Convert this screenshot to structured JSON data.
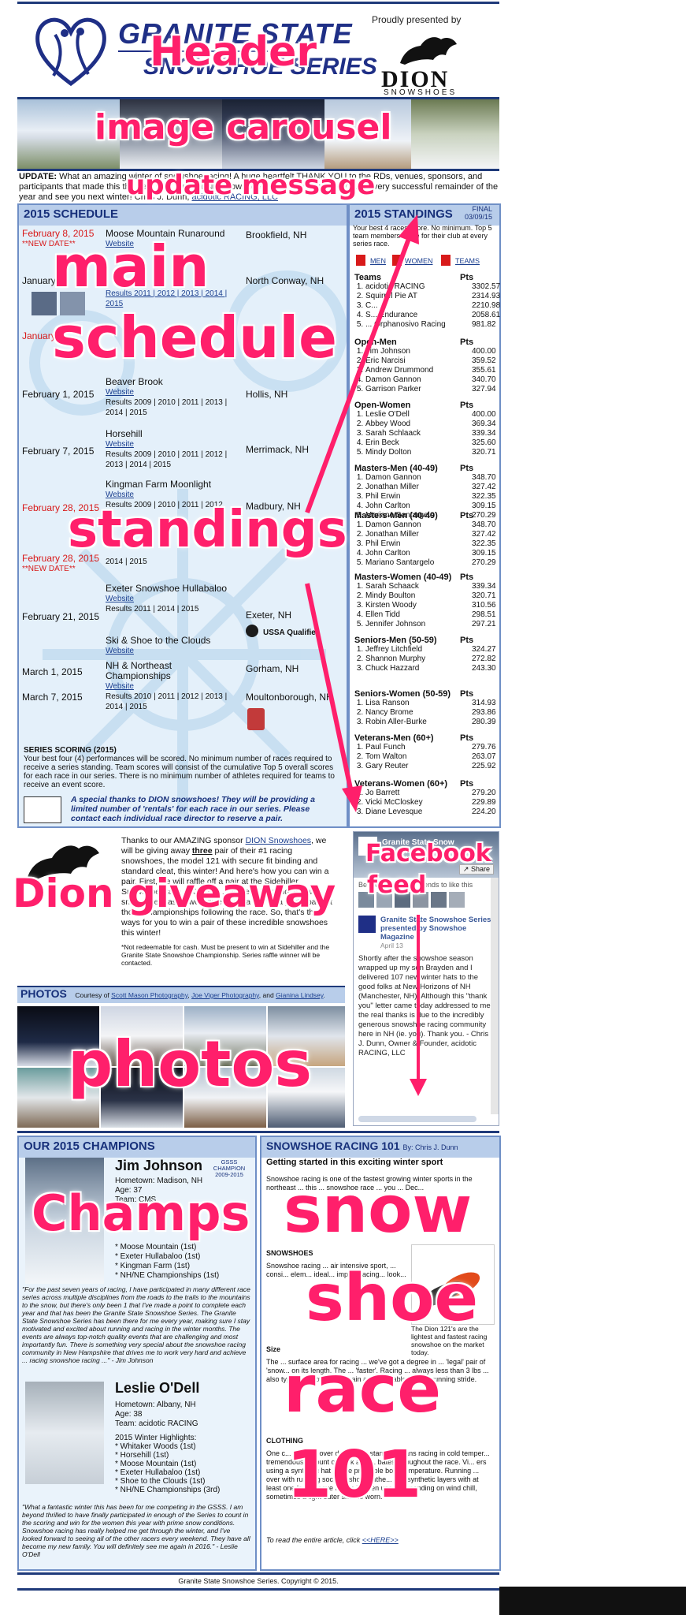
{
  "header": {
    "title": "GRANITE STATE",
    "subtitle": "SNOWSHOE SERIES",
    "presented_by": "Proudly presented by",
    "sponsor_name": "DION",
    "sponsor_tag": "SNOWSHOES"
  },
  "update": {
    "label": "UPDATE:",
    "text": "What an amazing winter of snowshoe racing! A huge heartfelt THANK YOU to the RDs, venues, sponsors, and participants that made this the best year ever for NH snowshoe racing. We hope you have a very successful remainder of the year and see you next winter! Chris J. Dunn,",
    "link": "acidotic RACING, LLC"
  },
  "schedule": {
    "title": "2015 SCHEDULE",
    "rows": [
      {
        "date": "February 8, 2015",
        "note": "**NEW DATE**",
        "event": "Moose Mountain Runaround",
        "links": "Website",
        "location": "Brookfield, NH"
      },
      {
        "date": "January",
        "note": "",
        "event": "",
        "links": "Results 2011 | 2012 | 2013 | 2014 | 2015",
        "location": "North Conway, NH"
      },
      {
        "date": "January",
        "note": "",
        "event": "",
        "links": "",
        "location": ""
      },
      {
        "date": "February 1, 2015",
        "note": "",
        "event": "Beaver Brook",
        "links": "Website",
        "results": "Results 2009 | 2010 | 2011 | 2013 | 2014 | 2015",
        "location": "Hollis, NH"
      },
      {
        "date": "February 7, 2015",
        "note": "",
        "event": "Horsehill",
        "links": "Website",
        "results": "Results 2009 | 2010 | 2011 | 2012 | 2013 | 2014 | 2015",
        "location": "Merrimack, NH"
      },
      {
        "date": "February 28, 2015",
        "note": "",
        "event": "Kingman Farm Moonlight",
        "links": "Website",
        "results": "Results 2009 | 2010 | 2011 | 2012",
        "location": "Madbury, NH"
      },
      {
        "date": "February 28, 2015",
        "note": "**NEW DATE**",
        "event": "",
        "links": "",
        "results": "2014 | 2015",
        "location": "Ma...H"
      },
      {
        "date": "February 21, 2015",
        "note": "",
        "event": "Exeter Snowshoe Hullabaloo",
        "links": "Website",
        "results": "Results 2011 | 2014 | 2015",
        "location": "Exeter, NH"
      },
      {
        "date": "",
        "note": "",
        "event": "Ski & Shoe to the Clouds",
        "links": "Website",
        "results": "",
        "location": "USSA Qualifier"
      },
      {
        "date": "March 1, 2015",
        "note": "",
        "event": "NH & Northeast Championships",
        "links": "Website",
        "results": "Results 2010 | 2011 | 2012 | 2013 | 2014 | 2015",
        "location": "Gorham, NH"
      },
      {
        "date": "March 7, 2015",
        "note": "",
        "event": "",
        "links": "",
        "results": "",
        "location": "Moultonborough, NH"
      }
    ],
    "scoring_title": "SERIES SCORING (2015)",
    "scoring_text": "Your best four (4) performances will be scored. No minimum number of races required to receive a series standing. Team scores will consist of the cumulative Top 5 overall scores for each race in our series. There is no minimum number of athletes required for teams to receive an event score.",
    "thanks": "A special thanks to DION snowshoes! They will be providing a limited number of 'rentals' for each race in our series. Please contact each individual race director to reserve a pair."
  },
  "standings": {
    "title": "2015 STANDINGS",
    "final": "FINAL",
    "final_date": "03/09/15",
    "intro": "Your best 4 races score. No minimum. Top 5 team members score for their club at every series race.",
    "links": [
      "MEN",
      "WOMEN",
      "TEAMS"
    ],
    "groups": [
      {
        "name": "Teams",
        "rows": [
          [
            "acidotic RACING",
            "3302.57"
          ],
          [
            "Squirrel Pie AT",
            "2314.93"
          ],
          [
            "C...",
            "2210.98"
          ],
          [
            "S... Endurance",
            "2058.61"
          ],
          [
            "... Orphanosivo Racing",
            "981.82"
          ]
        ]
      },
      {
        "name": "Open-Men",
        "rows": [
          [
            "Tim Johnson",
            "400.00"
          ],
          [
            "Eric Narcisi",
            "359.52"
          ],
          [
            "Andrew Drummond",
            "355.61"
          ],
          [
            "Damon Gannon",
            "340.70"
          ],
          [
            "Garrison Parker",
            "327.94"
          ]
        ]
      },
      {
        "name": "Open-Women",
        "rows": [
          [
            "Leslie O'Dell",
            "400.00"
          ],
          [
            "Abbey Wood",
            "369.34"
          ],
          [
            "Sarah Schlaack",
            "339.34"
          ],
          [
            "Erin Beck",
            "325.60"
          ],
          [
            "Mindy Dolton",
            "320.71"
          ]
        ]
      },
      {
        "name": "Masters-Men (40-49)",
        "rows": [
          [
            "Damon Gannon",
            "348.70"
          ],
          [
            "Jonathan Miller",
            "327.42"
          ],
          [
            "Phil Erwin",
            "322.35"
          ],
          [
            "John Carlton",
            "309.15"
          ],
          [
            "Mariano Santargelo",
            "270.29"
          ]
        ]
      },
      {
        "name": "Masters-Men (40-49)",
        "rows": [
          [
            "Damon Gannon",
            "348.70"
          ],
          [
            "Jonathan Miller",
            "327.42"
          ],
          [
            "Phil Erwin",
            "322.35"
          ],
          [
            "John Carlton",
            "309.15"
          ],
          [
            "Mariano Santargelo",
            "270.29"
          ]
        ]
      },
      {
        "name": "Masters-Women (40-49)",
        "rows": [
          [
            "Sarah Schaack",
            "339.34"
          ],
          [
            "Mindy Boulton",
            "320.71"
          ],
          [
            "Kirsten Woody",
            "310.56"
          ],
          [
            "Ellen Tidd",
            "298.51"
          ],
          [
            "Jennifer Johnson",
            "297.21"
          ]
        ]
      },
      {
        "name": "Seniors-Men (50-59)",
        "rows": [
          [
            "Jeffrey Litchfield",
            "324.27"
          ],
          [
            "Shannon Murphy",
            "272.82"
          ],
          [
            "Chuck Hazzard",
            "243.30"
          ]
        ]
      },
      {
        "name": "Seniors-Women (50-59)",
        "rows": [
          [
            "Lisa Ranson",
            "314.93"
          ],
          [
            "Nancy Brome",
            "293.86"
          ],
          [
            "Robin Aller-Burke",
            "280.39"
          ]
        ]
      },
      {
        "name": "Veterans-Men (60+)",
        "rows": [
          [
            "Paul Funch",
            "279.76"
          ],
          [
            "Tom Walton",
            "263.07"
          ],
          [
            "Gary Reuter",
            "225.92"
          ]
        ]
      },
      {
        "name": "Veterans-Women (60+)",
        "rows": [
          [
            "Jo Barrett",
            "279.20"
          ],
          [
            "Vicki McCloskey",
            "229.89"
          ],
          [
            "Diane Levesque",
            "224.20"
          ]
        ]
      }
    ],
    "pts_label": "Pts"
  },
  "giveaway": {
    "intro_a": "Thanks to our AMAZING sponsor",
    "sponsor_link": "DION Snowshoes",
    "intro_b": ", we will be giving away",
    "three": "three",
    "body": "pair of their #1 racing snowshoes, the model 121 with secure fit binding and standard cleat, this winter! And here's how you can win a pair. First, we will raffle off a pair at the Sidehiller Snowshoe Race in Center ... at the ... Second, we will ... snowshoe. Lastly, we'll give away a pair to a participant at those championships following the race. So, that's three ways for you to win a pair of these incredible snowshoes this winter!",
    "footnote": "*Not redeemable for cash. Must be present to win at Sidehiller and the Granite State Snowshoe Championship. Series raffle winner will be contacted."
  },
  "facebook": {
    "page": "Granite State Snow",
    "share": "Share",
    "friends": "Be the first of your friends to like this",
    "post_title": "Granite State Snowshoe Series presented by Snowshoe Magazine",
    "post_date": "April 13",
    "post_text": "Shortly after the snowshoe season wrapped up my son Brayden and I delivered 107 new winter hats to the good folks at New Horizons of NH (Manchester, NH). Although this \"thank you\" letter came today addressed to me, the real thanks is due to the incredibly generous snowshoe racing community here in NH (ie. you). Thank you. - Chris J. Dunn, Owner & Founder, acidotic RACING, LLC"
  },
  "photos": {
    "title": "PHOTOS",
    "credit_prefix": "Courtesy of",
    "credit_a": "Scott Mason Photography",
    "credit_b": "Joe Viger Photography",
    "credit_and": ", and",
    "credit_c": "Gianina Lindsey"
  },
  "champions": {
    "title": "OUR 2015 CHAMPIONS",
    "men": {
      "name": "Jim Johnson",
      "badge": "GSSS CHAMPION 2009-2015",
      "hometown": "Hometown: Madison, NH",
      "age": "Age: 37",
      "team": "Team: CMS",
      "highlights": "* Moose Mountain (1st)\n* Exeter Hullabaloo (1st)\n* Kingman Farm (1st)\n* NH/NE Championships (1st)",
      "quote": "\"For the past seven years of racing, I have participated in many different race series across multiple disciplines from the roads to the trails to the mountains to the snow, but there's only been 1 that I've made a point to complete each year and that has been the Granite State Snowshoe Series. The Granite State Snowshoe Series has been there for me every year, making sure I stay motivated and excited about running and racing in the winter months. The events are always top-notch quality events that are challenging and most importantly fun. There is something very special about the snowshoe racing community in New Hampshire that drives me to work very hard and achieve ... racing snowshoe racing ...\" - Jim Johnson"
    },
    "women": {
      "name": "Leslie O'Dell",
      "hometown": "Hometown: Albany, NH",
      "age": "Age: 38",
      "team": "Team: acidotic RACING",
      "highlights_label": "2015 Winter Highlights:",
      "highlights": "* Whitaker Woods (1st)\n* Horsehill (1st)\n* Moose Mountain (1st)\n* Exeter Hullabaloo (1st)\n* Shoe to the Clouds (1st)\n* NH/NE Championships (3rd)",
      "quote": "\"What a fantastic winter this has been for me competing in the GSSS. I am beyond thrilled to have finally participated in enough of the Series to count in the scoring and win for the women this year with prime snow conditions. Snowshoe racing has really helped me get through the winter, and I've looked forward to seeing all of the other racers every weekend. They have all become my new family. You will definitely see me again in 2016.\" - Leslie O'Dell"
    }
  },
  "racing101": {
    "title": "SNOWSHOE RACING 101",
    "byline": "By: Chris J. Dunn",
    "heading": "Getting started in this exciting winter sport",
    "p1": "Snowshoe racing is one of the fastest growing winter sports in the northeast ... this ... snowshoe race ... you ... Dec...",
    "snowshoes_h": "SNOWSHOES",
    "p2": "Snowshoe racing ... air intensive sport, ... consi... elem... ideal... impo... racing... look...",
    "side_caption": "The Dion 121's are the lightest and fastest racing snowshoe on the market today.",
    "size_h": "Size",
    "p3": "The ... surface area for racing ... we've got a degree in ... 'legal' pair of 'snow... on its length. The ... 'faster'. Racing ... always less than 3 lbs ... also typically allow ... maintain a comfortable narrow running stride.",
    "clothing_h": "CLOTHING",
    "p4": "One c... make is over dressing. I stand... means racing in cold temper... tremendous amount of work and ... bates throughout the race. Vi... ers using a synthetic hat as the pr... table body temperature. Running ... over with running socks & shoes rathe... ight synthetic layers with at least one long-sleeve article is often used. Depending on wind chill, sometimes a light outer shell is worn.",
    "read_more": "To read the entire article, click",
    "read_link": "<<HERE>>"
  },
  "footer": {
    "copyright": "Granite State Snowshoe Series. Copyright © 2015."
  },
  "overlays": {
    "header": "Header",
    "carousel": "image carousel",
    "update": "update message",
    "main1": "main",
    "main2": "schedule",
    "standings": "standings",
    "facebook1": "Facebook",
    "facebook2": "feed",
    "giveaway": "Dion giveaway",
    "photos": "photos",
    "champs": "Champs",
    "race1": "snow",
    "race2": "shoe",
    "race3": "race",
    "race4": "101"
  },
  "colors": {
    "navy": "#1f3a7a",
    "panel_bg": "#eaf3fb",
    "panel_head": "#b8cdea",
    "overlay": "#ff1f6b",
    "date_red": "#d81a1a"
  }
}
